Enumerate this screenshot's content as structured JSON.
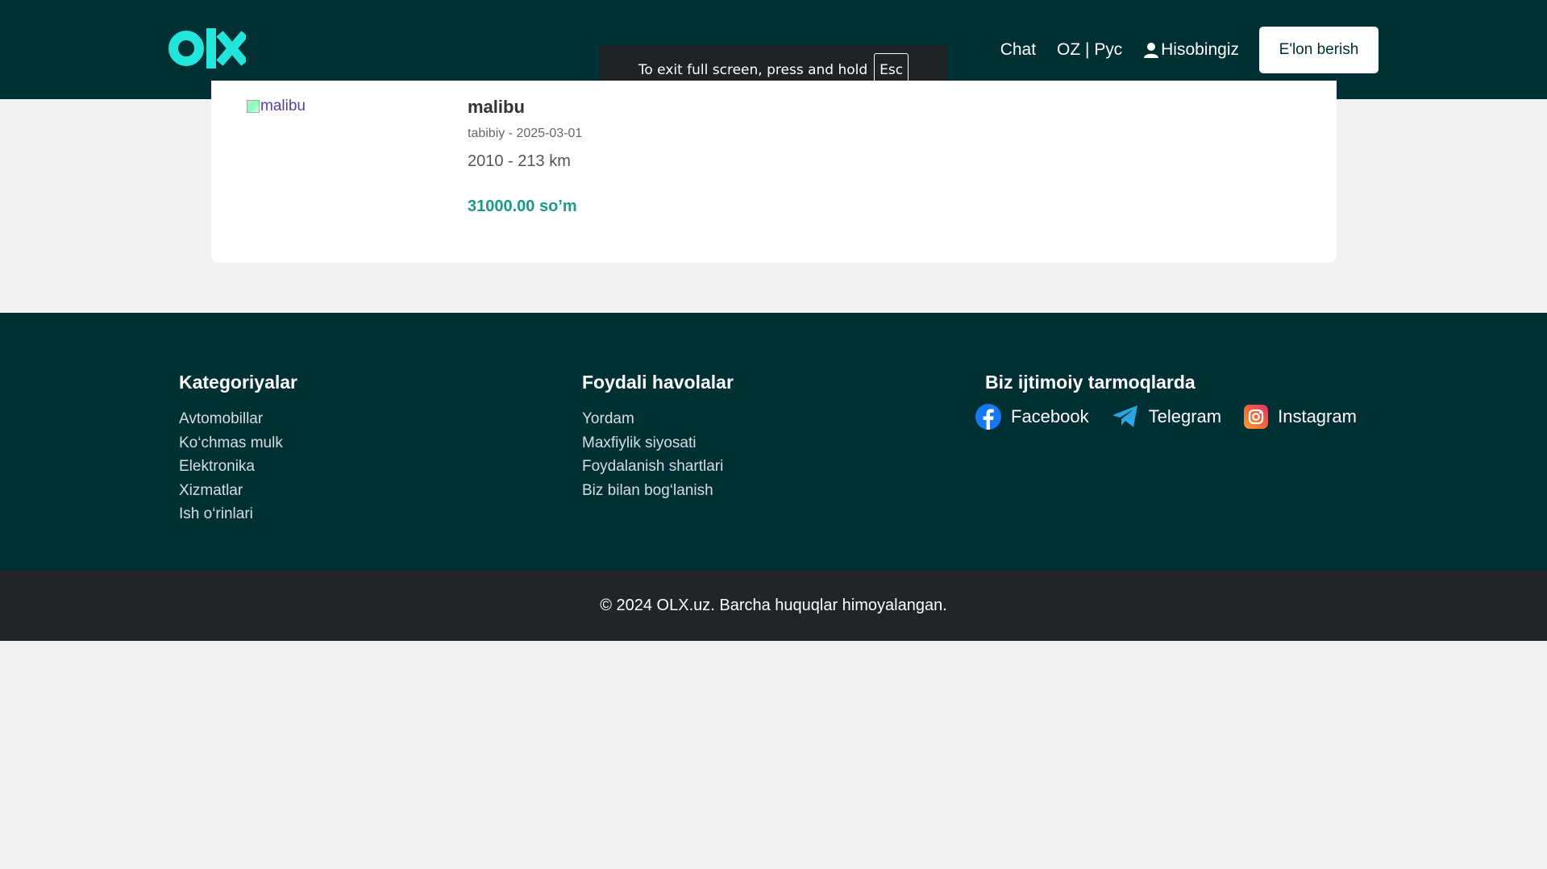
{
  "header": {
    "logo_text": "olx",
    "nav": {
      "chat": "Chat",
      "language": "OZ | Рус",
      "account": "Hisobingiz",
      "post_ad": "E'lon berish"
    }
  },
  "fullscreen_notice": {
    "text": "To exit full screen, press and hold",
    "key": "Esc"
  },
  "listing": {
    "image_alt": "malibu",
    "title": "malibu",
    "meta": "tabibiy - 2025-03-01",
    "specs": "2010 - 213 km",
    "price": "31000.00 so’m"
  },
  "footer": {
    "categories": {
      "title": "Kategoriyalar",
      "items": [
        "Avtomobillar",
        "Ko‘chmas mulk",
        "Elektronika",
        "Xizmatlar",
        "Ish o‘rinlari"
      ]
    },
    "links": {
      "title": "Foydali havolalar",
      "items": [
        "Yordam",
        "Maxfiylik siyosati",
        "Foydalanish shartlari",
        "Biz bilan bog‘lanish"
      ]
    },
    "social": {
      "title": "Biz ijtimoiy tarmoqlarda",
      "facebook": "Facebook",
      "telegram": "Telegram",
      "instagram": "Instagram"
    },
    "copyright": "© 2024 OLX.uz. Barcha huquqlar himoyalangan."
  },
  "colors": {
    "header_bg": "#002f34",
    "brand_teal": "#23e5db",
    "price": "#1a9a8a",
    "copyright_bg": "#212529"
  },
  "icons": [
    "olx-logo",
    "user-icon",
    "facebook-icon",
    "telegram-icon",
    "instagram-icon",
    "broken-image-icon"
  ]
}
